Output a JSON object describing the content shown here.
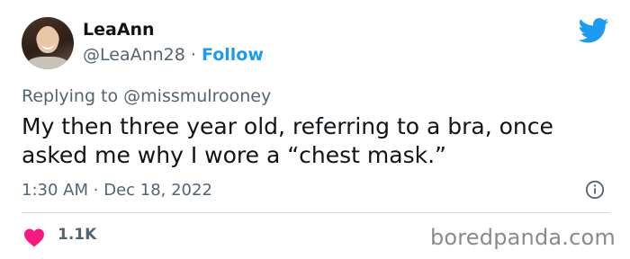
{
  "author": {
    "display_name": "LeaAnn",
    "handle": "@LeaAnn28",
    "separator": "·",
    "follow_label": "Follow"
  },
  "reply": {
    "prefix": "Replying to",
    "mention": "@missmulrooney"
  },
  "tweet": {
    "text": "My then three year old, referring to a bra, once asked me why I wore a “chest mask.”",
    "time": "1:30 AM",
    "separator": "·",
    "date": "Dec 18, 2022"
  },
  "engagement": {
    "likes": "1.1K"
  },
  "watermark": "boredpanda.com",
  "icons": {
    "brand": "twitter-bird-icon",
    "info": "info-icon",
    "like": "heart-icon"
  },
  "colors": {
    "accent": "#1d9bf0",
    "heart": "#f91880",
    "muted": "#536471",
    "text": "#0f1419"
  }
}
